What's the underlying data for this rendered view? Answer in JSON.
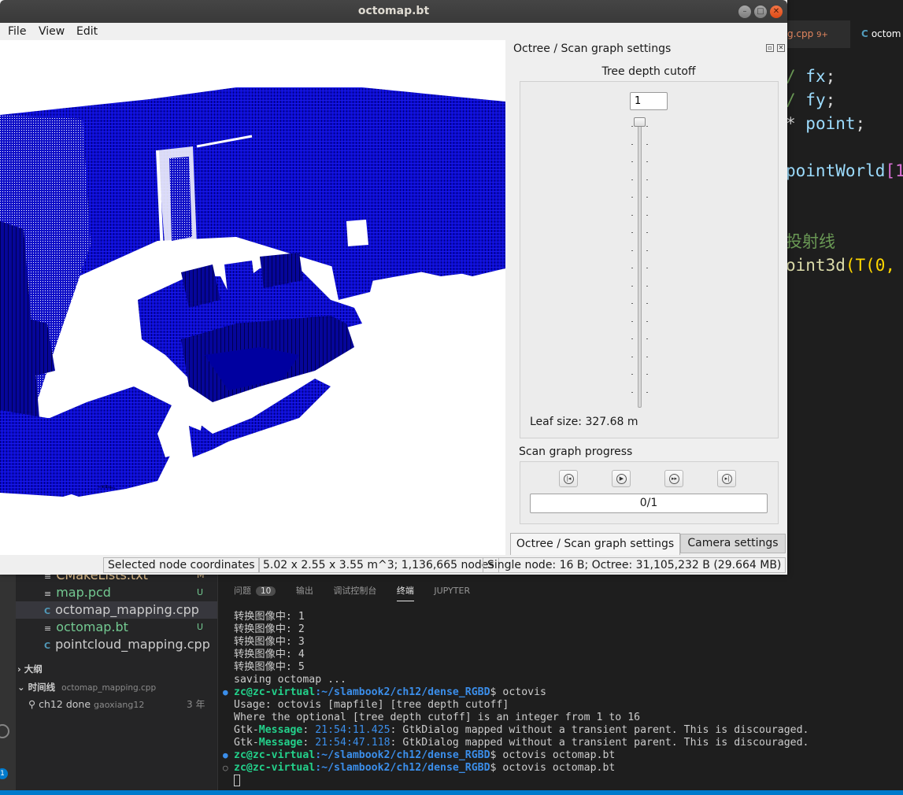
{
  "window": {
    "title": "octomap.bt",
    "menu": [
      "File",
      "View",
      "Edit"
    ]
  },
  "dock": {
    "title": "Octree / Scan graph settings",
    "tree_depth_label": "Tree depth cutoff",
    "tree_depth_value": "1",
    "leaf_size": "Leaf size:  327.68 m",
    "scan_graph_label": "Scan graph progress",
    "progress_text": "0/1",
    "tabs": [
      "Octree / Scan graph settings",
      "Camera settings"
    ]
  },
  "statusbar": {
    "selected": "Selected node coordinates",
    "dims": "5.02 x 2.55 x 3.55 m^3; 1,136,665 nodes",
    "memory": "Single node: 16 B; Octree: 31,105,232 B (29.664 MB)"
  },
  "editor": {
    "tabs": [
      {
        "label": "g.cpp",
        "badge": "9+"
      },
      {
        "label": "octom"
      }
    ],
    "code_lines": [
      {
        "a": "/ ",
        "b": "fx",
        "c": ";"
      },
      {
        "a": "/ ",
        "b": "fy",
        "c": ";"
      },
      {
        "a": "* ",
        "b": "point",
        "c": ";"
      },
      {
        "a": "",
        "b": "",
        "c": ""
      },
      {
        "a": "pointWorld",
        "b": "[1",
        "c": ""
      },
      {
        "a": "",
        "b": "",
        "c": ""
      },
      {
        "a": "",
        "b": "",
        "c": ""
      },
      {
        "a": "投射线",
        "b": "",
        "c": ""
      },
      {
        "a": "oint3d",
        "b": "(T(0,",
        "c": ""
      }
    ]
  },
  "explorer": {
    "files": [
      {
        "name": "CMakeLists.txt",
        "badge": "M"
      },
      {
        "name": "map.pcd",
        "badge": "U"
      },
      {
        "name": "octomap_mapping.cpp",
        "badge": ""
      },
      {
        "name": "octomap.bt",
        "badge": "U"
      },
      {
        "name": "pointcloud_mapping.cpp",
        "badge": ""
      }
    ],
    "outline": "大纲",
    "timeline": "时间线",
    "timeline_file": "octomap_mapping.cpp",
    "commit": "ch12 done",
    "author": "gaoxiang12",
    "age": "3 年"
  },
  "panel": {
    "tabs": [
      "问题",
      "输出",
      "调试控制台",
      "终端",
      "JUPYTER"
    ],
    "problems_count": "10",
    "terminal": [
      "转换图像中: 1",
      "转换图像中: 2",
      "转换图像中: 3",
      "转换图像中: 4",
      "转换图像中: 5",
      "saving octomap ...",
      "Usage: octovis [mapfile] [tree depth cutoff]",
      "Where the optional [tree depth cutoff] is an integer from 1 to 16"
    ],
    "prompt_user": "zc@zc-virtual",
    "prompt_path": ":~/slambook2/ch12/dense_RGBD",
    "cmd1": "$ octovis",
    "cmd2": "$ octovis octomap.bt",
    "cmd3": "$ octovis octomap.bt",
    "gtk_prefix": "Gtk-",
    "gtk_msg": "Message",
    "gtk_ts1": "21:54:11.425",
    "gtk_ts2": "21:54:47.118",
    "gtk_text": ": GtkDialog mapped without a transient parent. This is discouraged."
  },
  "colors": {
    "voxel": "#0a0ad2",
    "voxel_dark": "#00005a"
  }
}
